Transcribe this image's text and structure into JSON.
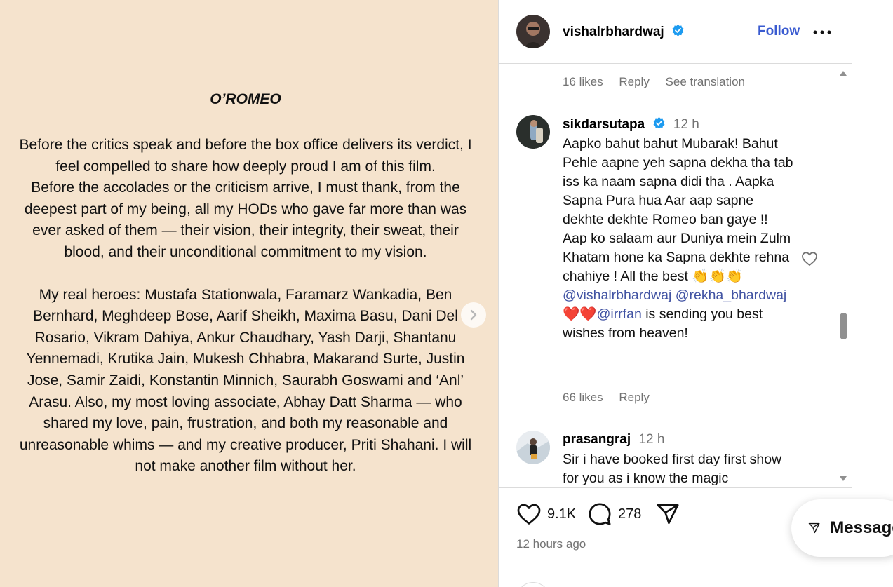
{
  "post_image": {
    "title": "O’ROMEO",
    "paragraph1": "Before the critics speak and before the box office delivers its verdict, I feel compelled to share how deeply proud I am of this film.",
    "paragraph2": "Before the accolades or the criticism arrive, I must thank, from the deepest part of my being, all my HODs who gave far more than was ever asked of them — their vision, their integrity, their sweat, their blood, and their unconditional commitment to my vision.",
    "paragraph3": "My real heroes: Mustafa Stationwala, Faramarz Wankadia, Ben Bernhard, Meghdeep Bose, Aarif Sheikh, Maxima Basu, Dani Del Rosario, Vikram Dahiya, Ankur Chaudhary, Yash Darji, Shantanu Yennemadi, Krutika Jain, Mukesh Chhabra, Makarand Surte, Justin Jose, Samir Zaidi, Konstantin Minnich, Saurabh Goswami and ‘Anl’ Arasu. Also, my most loving associate, Abhay Datt Sharma — who shared my love, pain, frustration, and both my reasonable and unreasonable whims — and my creative producer, Priti Shahani. I will not make another film without her."
  },
  "header": {
    "username": "vishalrbhardwaj",
    "follow_label": "Follow"
  },
  "previous_comment_meta": {
    "likes": "16 likes",
    "reply": "Reply",
    "translate": "See translation"
  },
  "comments": [
    {
      "username": "sikdarsutapa",
      "verified": true,
      "time": "12 h",
      "text_line1": "Aapko bahut bahut Mubarak! Bahut Pehle aapne yeh sapna dekha tha tab iss ka naam sapna didi tha . Aapka Sapna Pura hua Aar aap sapne dekhte dekhte Romeo ban gaye !! Aap ko salaam aur Duniya mein Zulm Khatam hone ka Sapna dekhte rehna chahiye ! All the best 👏👏👏",
      "mention1": "@vishalrbhardwaj",
      "mention2": "@rekha_bhardwaj",
      "hearts": "❤️❤️",
      "mention3": "@irrfan",
      "text_end": " is sending you best wishes from heaven!",
      "likes": "66 likes",
      "reply": "Reply"
    },
    {
      "username": "prasangraj",
      "verified": false,
      "time": "12 h",
      "text": "Sir i have booked first day first show for you as i know the magic"
    }
  ],
  "actions": {
    "like_count": "9.1K",
    "comment_count": "278",
    "time_ago": "12 hours ago"
  },
  "messages_button": {
    "label": "Messages"
  },
  "colors": {
    "image_background": "#f5e3cd",
    "accent": "#3a5bd0",
    "mention": "#4153a3",
    "verified": "#1d9bf0"
  }
}
